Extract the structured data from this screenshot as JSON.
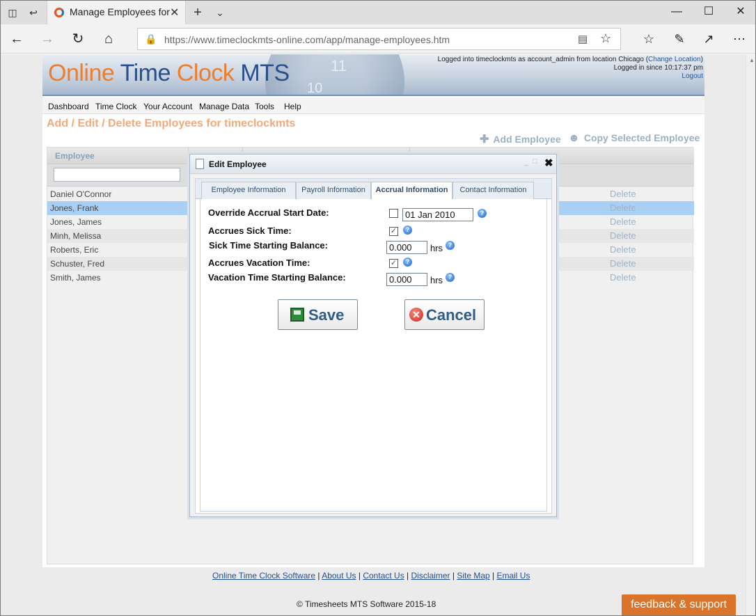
{
  "browser": {
    "tab_title": "Manage Employees for",
    "url": "https://www.timeclockmts-online.com/app/manage-employees.htm"
  },
  "site": {
    "logo": {
      "part1": "Online",
      "part2": "Time",
      "part3": "Clock",
      "part4": "MTS"
    },
    "clock_numerals": [
      "11",
      "10"
    ],
    "login_line1": "Logged into timeclockmts as account_admin from location Chicago (",
    "change_location": "Change Location",
    "login_line1_end": ")",
    "login_line2": "Logged in since 10:17:37 pm",
    "logout": "Logout",
    "menu": [
      "Dashboard",
      "Time Clock",
      "Your Account",
      "Manage Data",
      "Tools",
      "Help"
    ],
    "page_title": "Add / Edit / Delete Employees for timeclockmts",
    "add_employee": "Add Employee",
    "copy_employee": "Copy Selected Employee",
    "grid_header": "Employee",
    "employees": [
      {
        "name": "Daniel O'Connor",
        "delete": "Delete"
      },
      {
        "name": "Jones, Frank",
        "delete": "Delete"
      },
      {
        "name": "Jones, James",
        "delete": "Delete"
      },
      {
        "name": "Minh, Melissa",
        "delete": "Delete"
      },
      {
        "name": "Roberts, Eric",
        "delete": "Delete"
      },
      {
        "name": "Schuster, Fred",
        "delete": "Delete"
      },
      {
        "name": "Smith, James",
        "delete": "Delete"
      }
    ],
    "selected_row_color": "#a9cff5",
    "footer_links": [
      "Online Time Clock Software",
      "About Us",
      "Contact Us",
      "Disclaimer",
      "Site Map",
      "Email Us"
    ],
    "copyright": "© Timesheets MTS Software 2015-18",
    "feedback": "feedback & support"
  },
  "modal": {
    "title": "Edit Employee",
    "tabs": [
      "Employee Information",
      "Payroll Information",
      "Accrual Information",
      "Contact Information"
    ],
    "active_tab": "Accrual Information",
    "fields": {
      "override_label": "Override Accrual Start Date:",
      "override_checked": false,
      "override_date": "01 Jan 2010",
      "sick_label": "Accrues Sick Time:",
      "sick_checked": true,
      "sick_balance_label": "Sick Time Starting Balance:",
      "sick_balance": "0.000",
      "vacation_label": "Accrues Vacation Time:",
      "vacation_checked": true,
      "vacation_balance_label": "Vacation Time Starting Balance:",
      "vacation_balance": "0.000",
      "unit": "hrs"
    },
    "save": "Save",
    "cancel": "Cancel"
  }
}
